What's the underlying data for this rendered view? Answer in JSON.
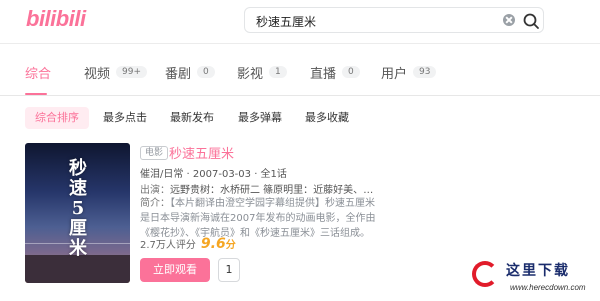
{
  "header": {
    "logo": "bilibili",
    "search_value": "秒速五厘米"
  },
  "tabs": [
    {
      "label": "综合",
      "count": ""
    },
    {
      "label": "视频",
      "count": "99+"
    },
    {
      "label": "番剧",
      "count": "0"
    },
    {
      "label": "影视",
      "count": "1"
    },
    {
      "label": "直播",
      "count": "0"
    },
    {
      "label": "用户",
      "count": "93"
    }
  ],
  "active_tab": "综合",
  "sort_options": [
    "综合排序",
    "最多点击",
    "最新发布",
    "最多弹幕",
    "最多收藏"
  ],
  "active_sort": "综合排序",
  "result": {
    "poster_title": "秒速5厘米",
    "type_badge": "电影",
    "title": "秒速五厘米",
    "meta": "催泪/日常 · 2007-03-03 · 全1话",
    "cast_label": "出演：",
    "cast": "远野贵树：水桥研二 篠原明里：近藤好美、尾上...",
    "desc_label": "简介：",
    "desc": "【本片翻译由澄空学园字幕组提供】秒速五厘米是日本导演新海诚在2007年发布的动画电影，全作由《樱花抄》、《宇航员》和《秒速五厘米》三话组成。导演结合…",
    "rating_count": "2.7万人评分",
    "score": "9.6",
    "score_unit": "分",
    "watch_label": "立即观看",
    "episode_label": "1"
  },
  "watermark": {
    "text_cn": "这里下载",
    "url": "www.herecdown.com"
  },
  "colors": {
    "brand_pink": "#fb7299",
    "score_orange": "#f5a623"
  }
}
